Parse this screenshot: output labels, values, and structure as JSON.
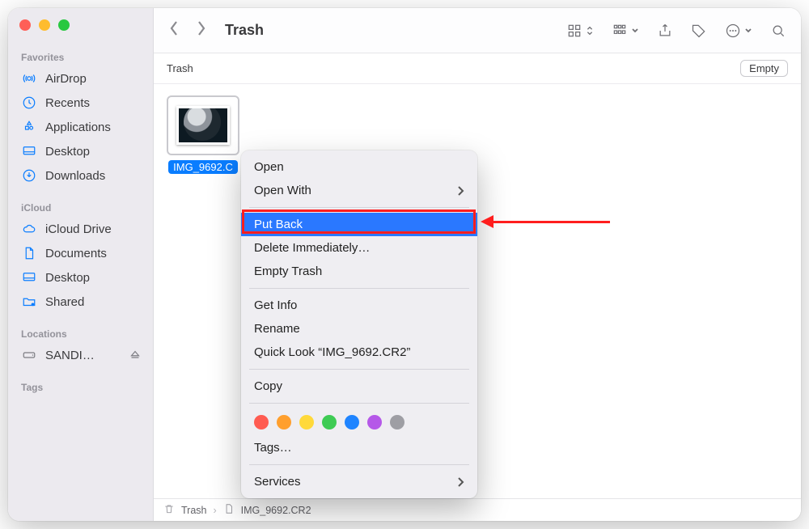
{
  "window_title": "Trash",
  "subheader_title": "Trash",
  "empty_button": "Empty",
  "sidebar": {
    "sections": [
      {
        "header": "Favorites",
        "items": [
          {
            "label": "AirDrop"
          },
          {
            "label": "Recents"
          },
          {
            "label": "Applications"
          },
          {
            "label": "Desktop"
          },
          {
            "label": "Downloads"
          }
        ]
      },
      {
        "header": "iCloud",
        "items": [
          {
            "label": "iCloud Drive"
          },
          {
            "label": "Documents"
          },
          {
            "label": "Desktop"
          },
          {
            "label": "Shared"
          }
        ]
      },
      {
        "header": "Locations",
        "items": [
          {
            "label": "SANDI…"
          }
        ]
      },
      {
        "header": "Tags",
        "items": []
      }
    ]
  },
  "file": {
    "label": "IMG_9692.C"
  },
  "context_menu": {
    "open": "Open",
    "open_with": "Open With",
    "put_back": "Put Back",
    "delete_immediately": "Delete Immediately…",
    "empty_trash": "Empty Trash",
    "get_info": "Get Info",
    "rename": "Rename",
    "quick_look": "Quick Look “IMG_9692.CR2”",
    "copy": "Copy",
    "tags": "Tags…",
    "services": "Services",
    "colors": [
      "#ff5b51",
      "#ff9f2e",
      "#ffd93a",
      "#3ecb54",
      "#1f84ff",
      "#b558e8",
      "#9e9ea4"
    ]
  },
  "pathbar": {
    "loc1": "Trash",
    "loc2": "IMG_9692.CR2"
  }
}
